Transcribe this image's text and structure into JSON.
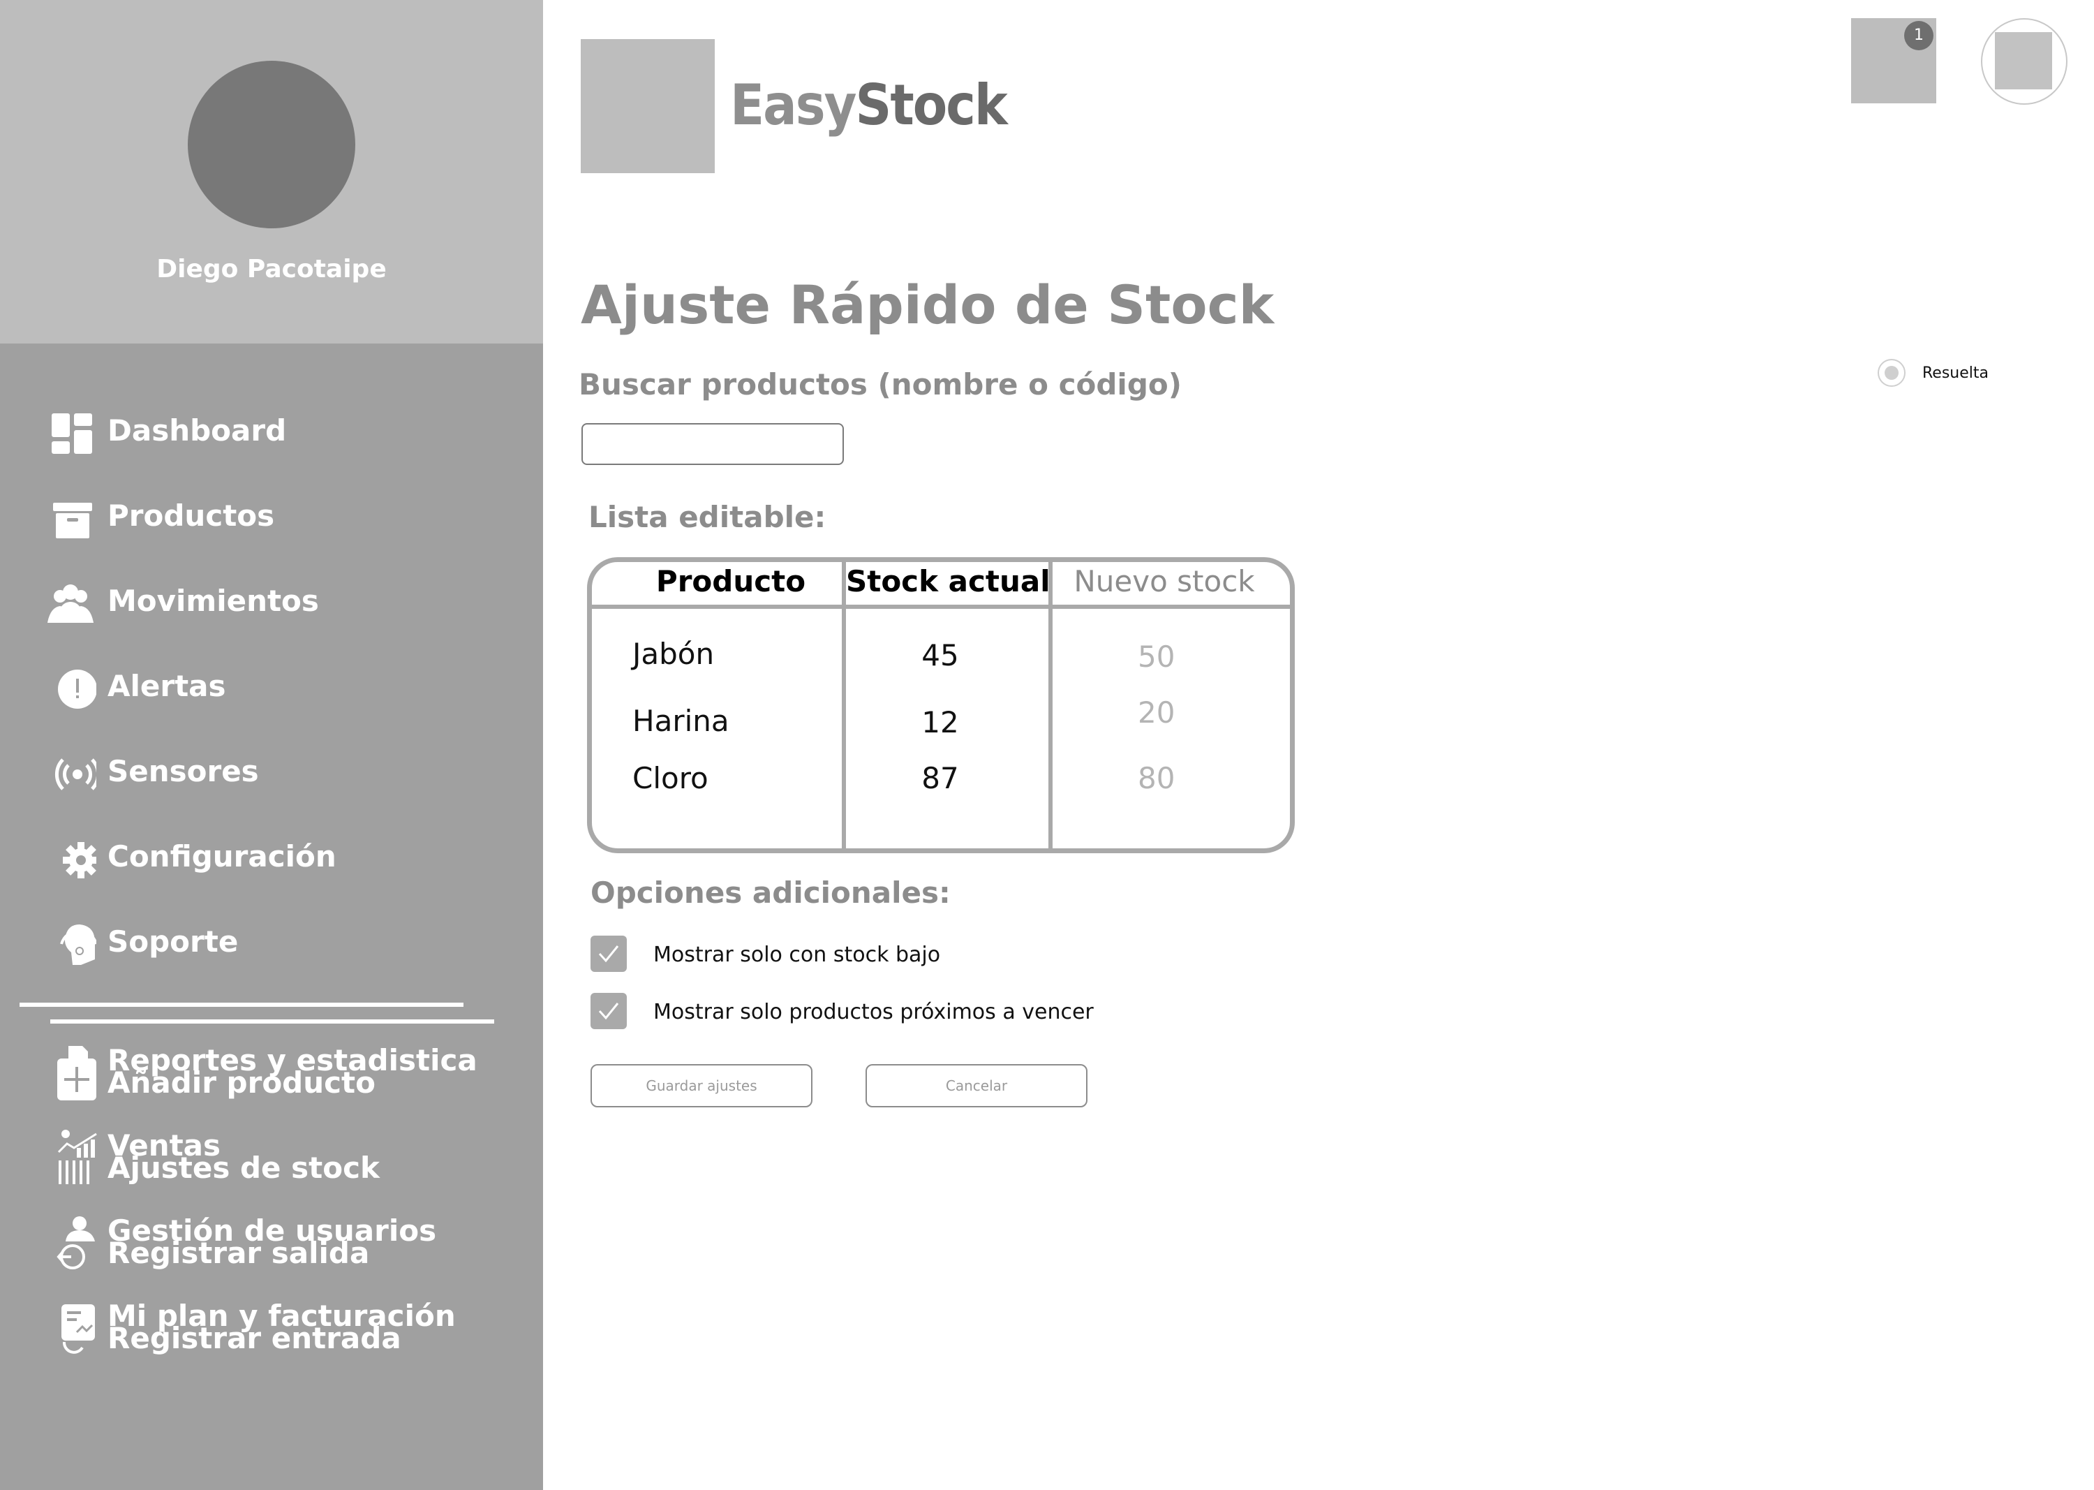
{
  "user": {
    "name": "Diego Pacotaipe"
  },
  "brand": {
    "part1": "Easy",
    "part2": "Stock"
  },
  "header": {
    "notification_count": "1"
  },
  "sidebar": {
    "items": [
      {
        "label": "Dashboard",
        "icon": "dashboard-icon"
      },
      {
        "label": "Productos",
        "icon": "archive-box-icon"
      },
      {
        "label": "Movimientos",
        "icon": "users-icon"
      },
      {
        "label": "Alertas",
        "icon": "alert-icon"
      },
      {
        "label": "Sensores",
        "icon": "sensor-icon"
      },
      {
        "label": "Configuración",
        "icon": "gear-icon"
      },
      {
        "label": "Soporte",
        "icon": "support-agent-icon"
      }
    ],
    "overlapped_items": [
      {
        "label_back": "Reportes y estadistica",
        "label_front": "Añadir producto",
        "icon": "add-file-icon"
      },
      {
        "label_back": "Ventas",
        "label_front": "Ajustes de stock",
        "icon": "sales-chart-icon"
      },
      {
        "label_back": "Gestión de usuarios",
        "label_front": "Registrar salida",
        "icon": "user-exit-icon"
      },
      {
        "label_back": "Mi plan y facturación",
        "label_front": "Registrar entrada",
        "icon": "billing-icon"
      }
    ]
  },
  "main": {
    "title": "Ajuste Rápido de Stock",
    "search": {
      "label": "Buscar productos (nombre o código)",
      "value": "",
      "placeholder": ""
    },
    "status": {
      "label": "Resuelta"
    },
    "list_label": "Lista editable:",
    "table": {
      "headers": [
        "Producto",
        "Stock actual",
        "Nuevo stock"
      ],
      "rows": [
        {
          "product": "Jabón",
          "current": "45",
          "new": "50"
        },
        {
          "product": "Harina",
          "current": "12",
          "new": "20"
        },
        {
          "product": "Cloro",
          "current": "87",
          "new": "80"
        }
      ]
    },
    "options": {
      "label": "Opciones adicionales:",
      "checkboxes": [
        {
          "label": "Mostrar solo con stock bajo",
          "checked": true
        },
        {
          "label": "Mostrar solo productos próximos a vencer",
          "checked": true
        }
      ]
    },
    "buttons": {
      "save": "Guardar ajustes",
      "cancel": "Cancelar"
    }
  },
  "colors": {
    "sidebar": "#a0a0a0",
    "profile_bg": "#bdbdbd",
    "text_muted": "#8c8c8c",
    "border": "#a9a9a9"
  }
}
